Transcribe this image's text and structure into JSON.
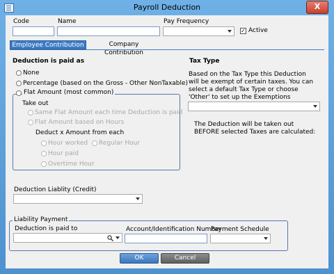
{
  "window": {
    "title": "Payroll Deduction",
    "close_label": "X"
  },
  "top": {
    "code_label": "Code",
    "code_value": "",
    "name_label": "Name",
    "name_value": "",
    "pay_frequency_label": "Pay Frequency",
    "pay_frequency_value": "",
    "active_label": "Active",
    "active_checked": true
  },
  "tabs": [
    {
      "label": "Employee Contribution",
      "active": true
    },
    {
      "label": "Company Contribution",
      "active": false
    }
  ],
  "paid_as": {
    "heading": "Deduction is paid as",
    "none": "None",
    "percentage": "Percentage  (based on the Gross - Other NonTaxable)",
    "flat_amount": "Flat Amount (most common)",
    "take_out": "Take out",
    "same_flat": "Same Flat Amount each time Deduction is paid",
    "flat_hours": "Flat Amount based on Hours",
    "deduct_x": "Deduct x Amount from each",
    "hour_worked": "Hour worked",
    "regular_hour": "Regular Hour",
    "hour_paid": "Hour paid",
    "overtime_hour": "Overtime Hour"
  },
  "tax_type": {
    "heading": "Tax Type",
    "description": "Based on the Tax Type this Deduction will be exempt of certain taxes. You can select a default Tax Type or choose 'Other' to set up the Exemptions yourself.",
    "value": "",
    "note": "The Deduction will be taken out BEFORE selected Taxes are calculated:"
  },
  "liability": {
    "account_label": "Deduction Liablity (Credit)",
    "account_value": "",
    "group_label": "Liability Payment",
    "paid_to_label": "Deduction is paid to",
    "paid_to_value": "",
    "account_id_label": "Account/Identification Number",
    "account_id_value": "",
    "schedule_label": "Payment Schedule",
    "schedule_value": ""
  },
  "buttons": {
    "ok": "OK",
    "cancel": "Cancel"
  },
  "icons": {
    "app": "list-icon",
    "search": "search-icon",
    "dropdown": "chevron-down-icon"
  }
}
